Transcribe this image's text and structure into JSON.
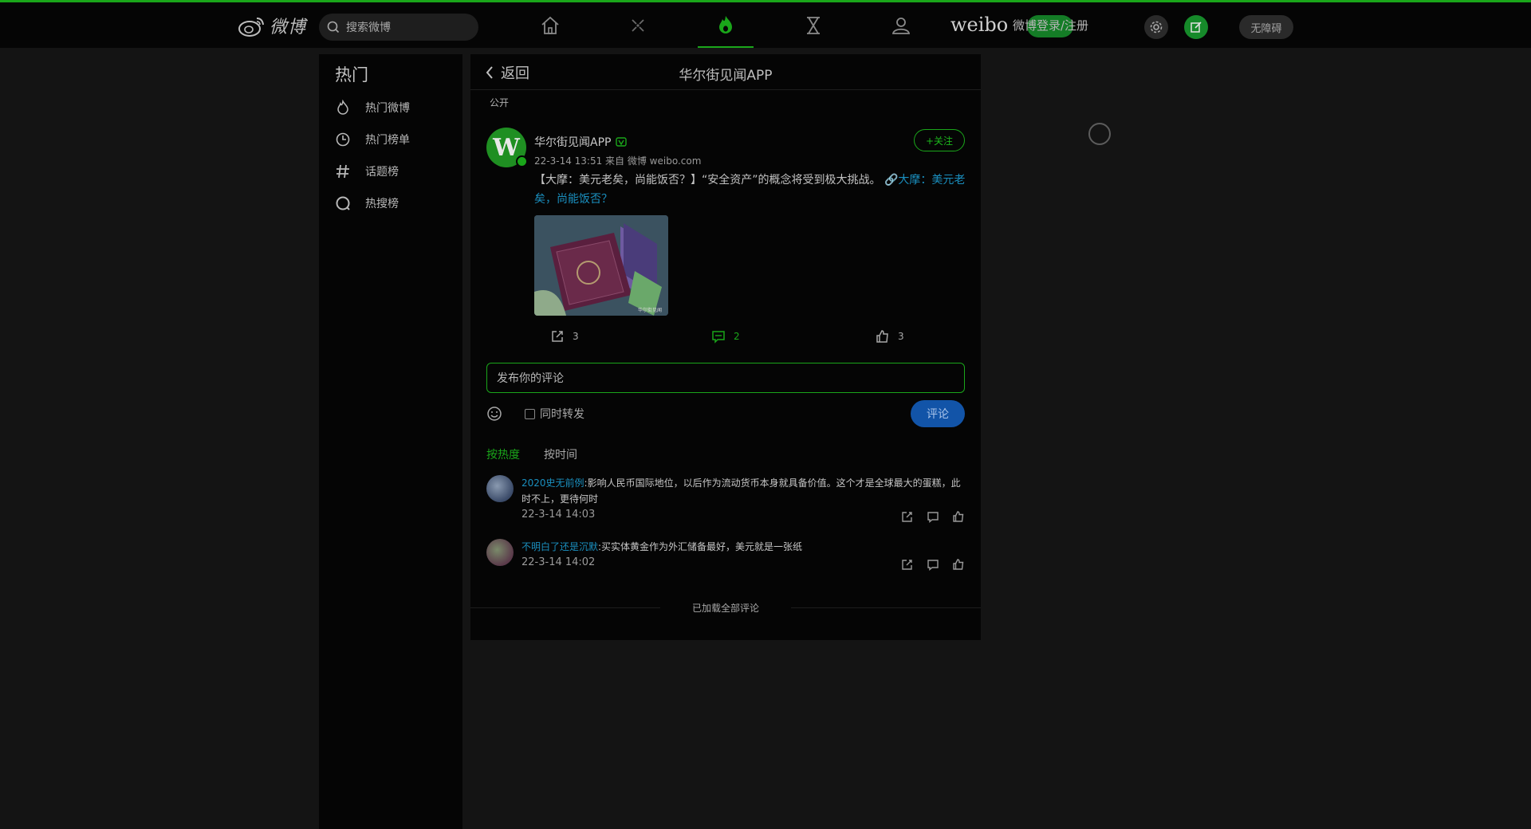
{
  "brand": {
    "logo_text": "微博",
    "search_placeholder": "搜索微博",
    "weibo_text": "weibo",
    "login_text": "微博登录/注册",
    "access_label": "无障碍"
  },
  "sidebar": {
    "title": "热门",
    "items": [
      {
        "label": "热门微博",
        "icon": "fire-icon"
      },
      {
        "label": "热门榜单",
        "icon": "clock-icon"
      },
      {
        "label": "话题榜",
        "icon": "hashtag-icon"
      },
      {
        "label": "热搜榜",
        "icon": "search-ring-icon"
      }
    ]
  },
  "main": {
    "back_label": "返回",
    "title": "华尔街见闻APP",
    "visibility": "公开",
    "post": {
      "author": "华尔街见闻APP",
      "meta": "22-3-14 13:51  来自 微博 weibo.com",
      "follow_label": "+关注",
      "text": "【大摩：美元老矣，尚能饭否？】“安全资产”的概念将受到极大挑战。",
      "link_text": "大摩：美元老矣，尚能饭否？",
      "repost_count": "3",
      "comment_count": "2",
      "like_count": "3"
    },
    "comment_box": {
      "placeholder": "发布你的评论",
      "repost_label": "同时转发",
      "submit_label": "评论"
    },
    "sort": {
      "hot": "按热度",
      "time": "按时间"
    },
    "comments": [
      {
        "user": "2020史无前例",
        "text": ":影响人民币国际地位，以后作为流动货币本身就具备价值。这个才是全球最大的蛋糕，此时不上，更待何时",
        "time": "22-3-14 14:03"
      },
      {
        "user": "不明白了还是沉默",
        "text": ":买实体黄金作为外汇储备最好，美元就是一张纸",
        "time": "22-3-14 14:02"
      }
    ],
    "end_text": "已加载全部评论"
  },
  "colors": {
    "accent": "#1aa61a",
    "link": "#1a8fbf",
    "button": "#1254a8"
  }
}
